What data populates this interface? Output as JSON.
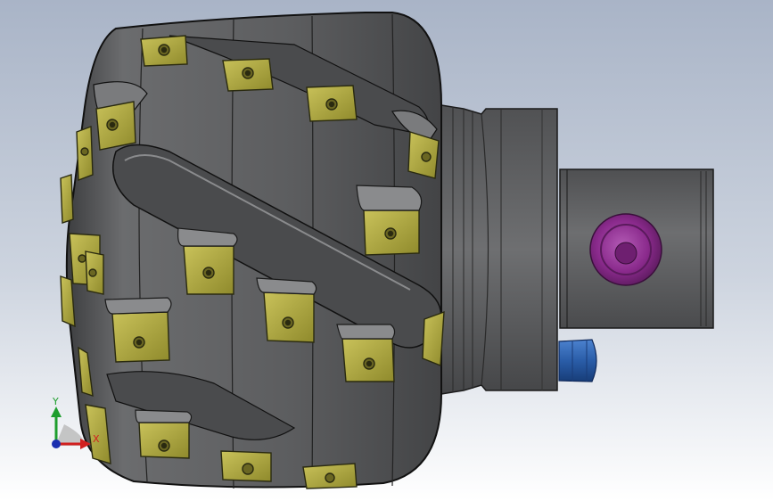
{
  "viewport": {
    "background_top": "#a9b4c7",
    "background_bottom": "#ffffff"
  },
  "model": {
    "body_color": "#5d5e60",
    "insert_color": "#b3ad3e",
    "shank_color": "#6a6b6d",
    "screw_color": "#8a2a8c",
    "coolant_nozzle_color": "#2a5da8"
  },
  "triad": {
    "x_label": "X",
    "y_label": "Y",
    "x_color": "#d11f1f",
    "y_color": "#1e9e2d",
    "z_color": "#1b2fb0"
  }
}
